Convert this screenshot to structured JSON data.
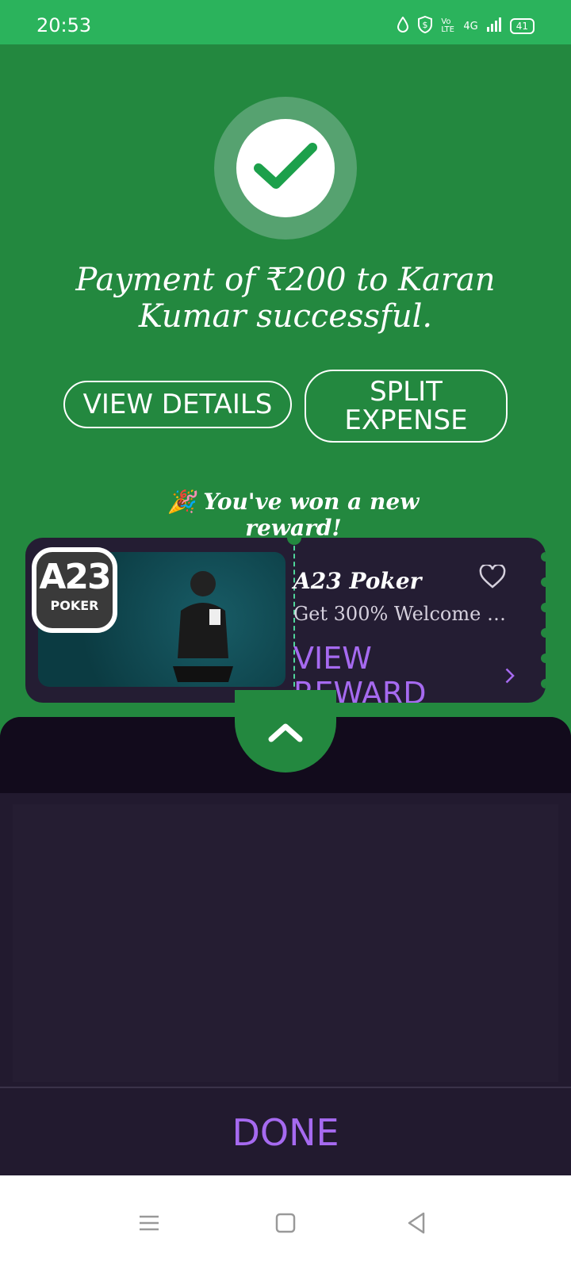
{
  "status": {
    "time": "20:53",
    "network": "4G",
    "volte": "Vo LTE",
    "battery": "41"
  },
  "payment": {
    "message": "Payment of ₹200 to Karan Kumar successful."
  },
  "buttons": {
    "view_details": "VIEW DETAILS",
    "split_expense": "SPLIT EXPENSE"
  },
  "reward": {
    "banner": "🎉 You've won a new reward!",
    "title": "A23 Poker",
    "description": "Get 300% Welcome Bo...",
    "cta": "VIEW REWARD",
    "logo_mark": "A23",
    "logo_text": "POKER"
  },
  "done": {
    "label": "DONE"
  },
  "colors": {
    "green": "#23883f",
    "purple": "#a66af0",
    "dark": "#221a2f"
  }
}
